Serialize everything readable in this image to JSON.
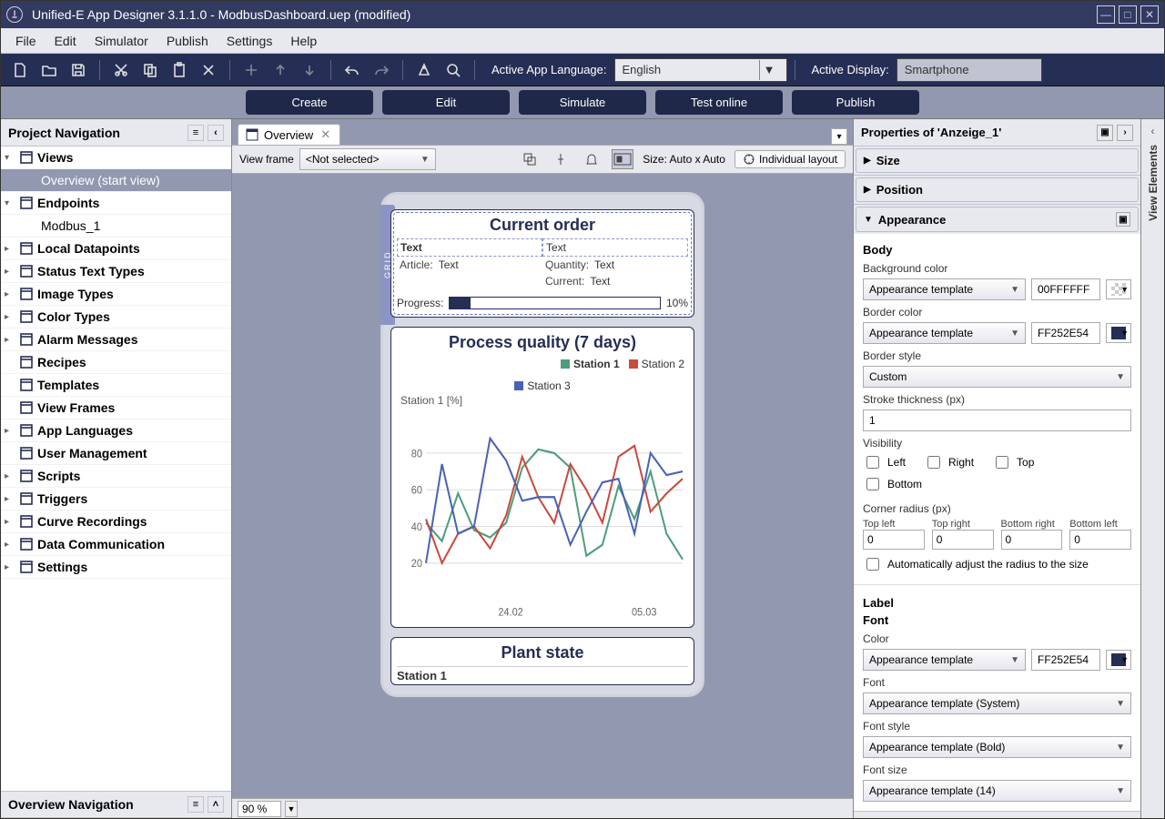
{
  "titlebar": {
    "text": "Unified-E App Designer 3.1.1.0 - ModbusDashboard.uep  (modified)"
  },
  "menu": [
    "File",
    "Edit",
    "Simulator",
    "Publish",
    "Settings",
    "Help"
  ],
  "toolbar": {
    "lang_label": "Active App Language:",
    "lang_value": "English",
    "display_label": "Active Display:",
    "display_value": "Smartphone"
  },
  "quick": [
    "Create",
    "Edit",
    "Simulate",
    "Test online",
    "Publish"
  ],
  "nav": {
    "title": "Project Navigation",
    "footer": "Overview Navigation",
    "items": [
      {
        "label": "Views",
        "bold": true,
        "chev": "▾"
      },
      {
        "label": "Overview (start view)",
        "indent": true,
        "selected": true
      },
      {
        "label": "Endpoints",
        "bold": true,
        "chev": "▾"
      },
      {
        "label": "Modbus_1",
        "indent": true
      },
      {
        "label": "Local Datapoints",
        "bold": true,
        "chev": "▸"
      },
      {
        "label": "Status Text Types",
        "bold": true,
        "chev": "▸"
      },
      {
        "label": "Image Types",
        "bold": true,
        "chev": "▸"
      },
      {
        "label": "Color Types",
        "bold": true,
        "chev": "▸"
      },
      {
        "label": "Alarm Messages",
        "bold": true,
        "chev": "▸"
      },
      {
        "label": "Recipes",
        "bold": true
      },
      {
        "label": "Templates",
        "bold": true
      },
      {
        "label": "View Frames",
        "bold": true
      },
      {
        "label": "App Languages",
        "bold": true,
        "chev": "▸"
      },
      {
        "label": "User Management",
        "bold": true
      },
      {
        "label": "Scripts",
        "bold": true,
        "chev": "▸"
      },
      {
        "label": "Triggers",
        "bold": true,
        "chev": "▸"
      },
      {
        "label": "Curve Recordings",
        "bold": true,
        "chev": "▸"
      },
      {
        "label": "Data Communication",
        "bold": true,
        "chev": "▸"
      },
      {
        "label": "Settings",
        "bold": true,
        "chev": "▸"
      }
    ]
  },
  "canvas": {
    "tab_label": "Overview",
    "viewframe_label": "View frame",
    "viewframe_value": "<Not selected>",
    "size_label": "Size: Auto x Auto",
    "layout_btn": "Individual layout",
    "zoom": "90 %",
    "grid_label": "GRID",
    "order": {
      "title": "Current order",
      "text1": "Text",
      "text2": "Text",
      "article_k": "Article:",
      "article_v": "Text",
      "qty_k": "Quantity:",
      "qty_v": "Text",
      "cur_k": "Current:",
      "cur_v": "Text",
      "progress_label": "Progress:",
      "progress_pct": "10%"
    },
    "chart": {
      "title": "Process quality (7 days)",
      "legend": [
        "Station 1",
        "Station 2",
        "Station 3"
      ],
      "ylabel": "Station 1 [%]"
    },
    "plant": {
      "title": "Plant state",
      "row1": "Station 1"
    }
  },
  "chart_data": {
    "type": "line",
    "ylabel": "Station 1 [%]",
    "ylim": [
      0,
      100
    ],
    "yticks": [
      20,
      40,
      60,
      80
    ],
    "xticks": [
      "24.02",
      "05.03"
    ],
    "series": [
      {
        "name": "Station 1",
        "color": "#4d9e7a",
        "values": [
          42,
          32,
          58,
          38,
          34,
          42,
          72,
          82,
          80,
          72,
          24,
          30,
          62,
          44,
          70,
          36,
          22
        ]
      },
      {
        "name": "Station 2",
        "color": "#c84b3d",
        "values": [
          44,
          20,
          36,
          40,
          28,
          46,
          78,
          56,
          42,
          74,
          60,
          42,
          78,
          84,
          48,
          58,
          66
        ]
      },
      {
        "name": "Station 3",
        "color": "#4a62b5",
        "values": [
          20,
          74,
          36,
          40,
          88,
          76,
          54,
          56,
          56,
          30,
          48,
          64,
          66,
          36,
          80,
          68,
          70
        ]
      }
    ]
  },
  "props": {
    "title": "Properties of 'Anzeige_1'",
    "sections": {
      "size": "Size",
      "position": "Position",
      "appearance": "Appearance"
    },
    "body_title": "Body",
    "bg_label": "Background color",
    "template_sel": "Appearance template",
    "bg_hex": "00FFFFFF",
    "border_label": "Border color",
    "border_hex": "FF252E54",
    "border_style_label": "Border style",
    "border_style_value": "Custom",
    "stroke_label": "Stroke thickness (px)",
    "stroke_value": "1",
    "visibility_label": "Visibility",
    "vis": [
      "Left",
      "Right",
      "Top",
      "Bottom"
    ],
    "corner_label": "Corner radius (px)",
    "corners": {
      "tl": "Top left",
      "tr": "Top right",
      "br": "Bottom right",
      "bl": "Bottom left"
    },
    "corner_val": "0",
    "auto_radius": "Automatically adjust the radius to the size",
    "label_title": "Label",
    "font_title": "Font",
    "color_label": "Color",
    "color_hex": "FF252E54",
    "font_label": "Font",
    "font_value": "Appearance template (System)",
    "fontstyle_label": "Font style",
    "fontstyle_value": "Appearance template (Bold)",
    "fontsize_label": "Font size",
    "fontsize_value": "Appearance template (14)"
  },
  "right_strip": "View Elements"
}
